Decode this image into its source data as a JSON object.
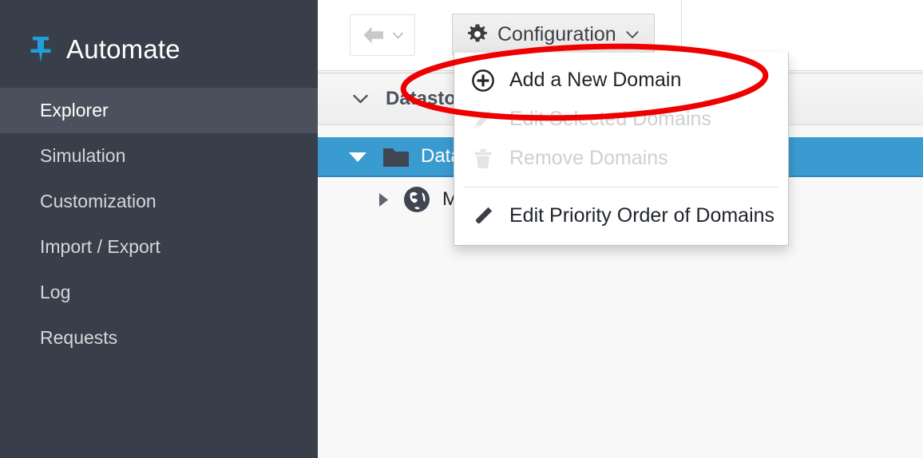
{
  "sidebar": {
    "brand": {
      "label": "Automate",
      "icon": "pushpin-icon",
      "accent_color": "#1fa0d8"
    },
    "items": [
      {
        "label": "Explorer",
        "active": true
      },
      {
        "label": "Simulation",
        "active": false
      },
      {
        "label": "Customization",
        "active": false
      },
      {
        "label": "Import / Export",
        "active": false
      },
      {
        "label": "Log",
        "active": false
      },
      {
        "label": "Requests",
        "active": false
      }
    ],
    "background_color": "#383f4a",
    "active_background_color": "#4b515c"
  },
  "toolbar": {
    "back_button": {
      "icon": "arrow-left-icon",
      "caret_icon": "chevron-down-icon",
      "label": ""
    },
    "configuration_button": {
      "label": "Configuration",
      "icon": "gear-icon",
      "caret_icon": "chevron-down-icon",
      "expanded": true
    }
  },
  "configuration_menu": {
    "items": [
      {
        "label": "Add a New Domain",
        "icon": "plus-circle-icon",
        "disabled": false
      },
      {
        "label": "Edit Selected Domains",
        "icon": "pencil-icon",
        "disabled": true
      },
      {
        "label": "Remove Domains",
        "icon": "trash-icon",
        "disabled": true
      },
      {
        "label": "Edit Priority Order of Domains",
        "icon": "pencil-icon",
        "disabled": false
      }
    ]
  },
  "tree_panel": {
    "accordion": {
      "label": "Datastore",
      "caret_icon": "chevron-down-icon",
      "expanded": true
    },
    "rows": [
      {
        "label": "Datastore",
        "icon": "folder-icon",
        "toggle_icon": "triangle-down-icon",
        "selected": true,
        "selected_color": "#3a9bd0"
      },
      {
        "label": "ManageIQ",
        "icon": "globe-icon",
        "toggle_icon": "triangle-right-icon",
        "selected": false
      }
    ]
  },
  "annotation": {
    "shape": "ellipse",
    "color": "#ee0000",
    "stroke_width": 7,
    "target": "Add a New Domain"
  }
}
